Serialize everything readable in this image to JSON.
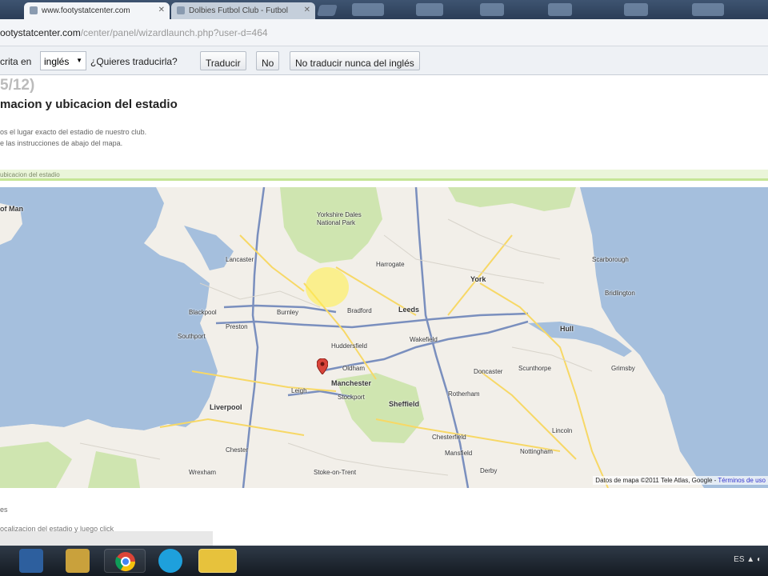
{
  "browser": {
    "tabs": [
      {
        "label": "www.footystatcenter.com",
        "active": true
      },
      {
        "label": "Dolbies Futbol Club - Futbol",
        "active": false
      }
    ],
    "url_host": "ootystatcenter.com",
    "url_path": "/center/panel/wizardlaunch.php?user-d=464"
  },
  "translate_bar": {
    "prefix": "crita en",
    "language": "inglés",
    "question": "¿Quieres traducirla?",
    "translate_button": "Traducir",
    "no_button": "No",
    "never_button": "No traducir nunca del inglés"
  },
  "page": {
    "step": "5/12)",
    "title": "macion y ubicacion del estadio",
    "instructions": [
      "os el lugar exacto del estadio de nuestro club.",
      "e las instrucciones de abajo del mapa."
    ],
    "location_bar_label": "ubicacion del estadio"
  },
  "map": {
    "labels": [
      "of Man",
      "Yorkshire Dales",
      "National Park",
      "Harrogate",
      "York",
      "Blackpool",
      "Preston",
      "Southport",
      "Burnley",
      "Bradford",
      "Leeds",
      "Huddersfield",
      "Wakefield",
      "Oldham",
      "Manchester",
      "Stockport",
      "Liverpool",
      "Sheffield",
      "Doncaster",
      "Scunthorpe",
      "Chester",
      "Wrexham",
      "Stoke-on-Trent",
      "Derby",
      "Nottingham",
      "Lincoln",
      "Mansfield",
      "Chesterfield",
      "Hull",
      "Scarborough",
      "Lancaster",
      "Leigh",
      "Rotherham",
      "Bridlington",
      "Grimsby"
    ],
    "attribution": "Datos de mapa ©2011 Tele Atlas, Google -",
    "terms_link": "Términos de uso",
    "colors": {
      "water": "#a5bfdd",
      "land": "#f2efe9",
      "park": "#cfe5b0",
      "motorway": "#7a8fbe",
      "road": "#f7d866"
    }
  },
  "below_map": {
    "label": "es",
    "hint": "ocalizacion del estadio y luego click"
  }
}
